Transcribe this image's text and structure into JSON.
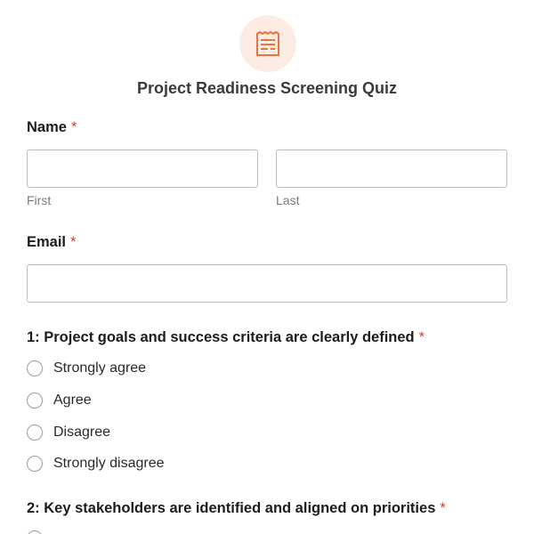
{
  "form": {
    "title": "Project Readiness Screening Quiz",
    "accent_color": "#e8743b",
    "icon": "form-document-icon"
  },
  "fields": {
    "name": {
      "label": "Name",
      "required_mark": "*",
      "first": {
        "value": "",
        "sublabel": "First"
      },
      "last": {
        "value": "",
        "sublabel": "Last"
      }
    },
    "email": {
      "label": "Email",
      "required_mark": "*",
      "value": ""
    }
  },
  "questions": [
    {
      "label": "1: Project goals and success criteria are clearly defined",
      "required_mark": "*",
      "options": [
        "Strongly agree",
        "Agree",
        "Disagree",
        "Strongly disagree"
      ]
    },
    {
      "label": "2: Key stakeholders are identified and aligned on priorities",
      "required_mark": "*",
      "options": []
    }
  ]
}
